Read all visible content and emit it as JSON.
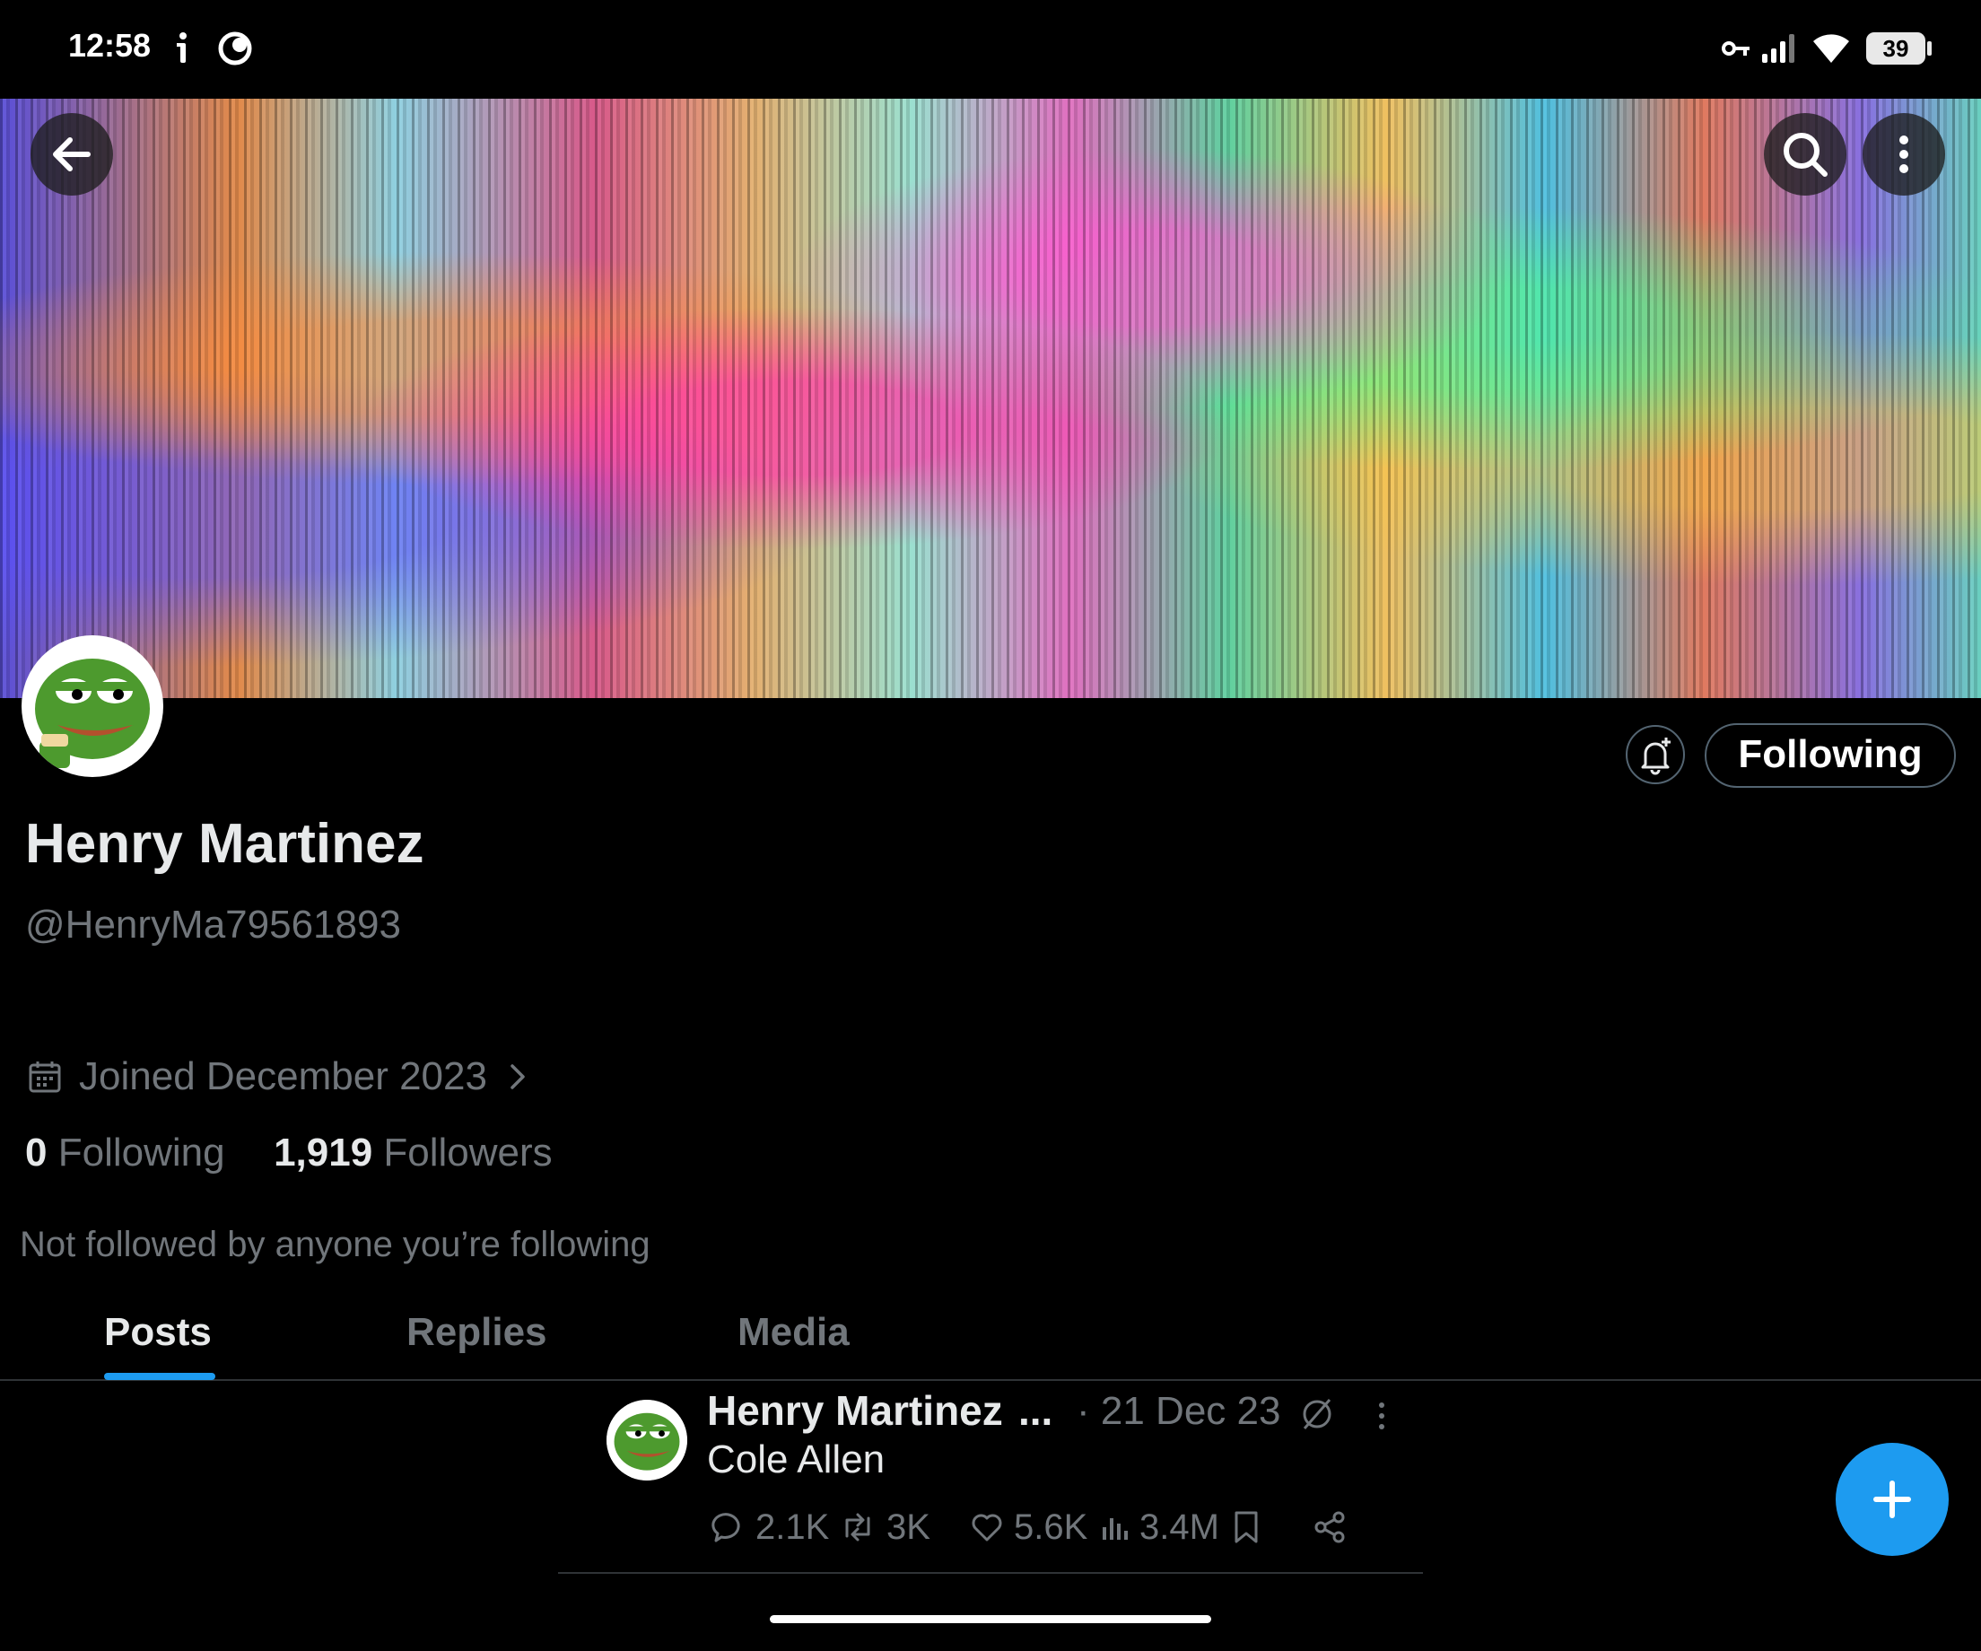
{
  "status_bar": {
    "time": "12:58",
    "battery": "39",
    "icons": [
      "notification-dot-icon",
      "moon-icon",
      "vpn-key-icon",
      "signal-icon",
      "wifi-icon",
      "battery-icon"
    ]
  },
  "header": {
    "icons": [
      "back-arrow-icon",
      "search-icon",
      "more-vertical-icon"
    ]
  },
  "profile": {
    "display_name": "Henry Martinez",
    "handle": "@HenryMa79561893",
    "joined": "Joined December 2023",
    "following_count": "0",
    "following_label": "Following",
    "followers_count": "1,919",
    "followers_label": "Followers",
    "not_followed": "Not followed by anyone you’re following",
    "follow_button": "Following"
  },
  "tabs": [
    {
      "label": "Posts",
      "active": true
    },
    {
      "label": "Replies",
      "active": false
    },
    {
      "label": "Media",
      "active": false
    }
  ],
  "post": {
    "author": "Henry Martinez",
    "ellipsis": "...",
    "date": "· 21 Dec 23",
    "text": "Cole Allen",
    "replies": "2.1K",
    "reposts": "3K",
    "likes": "5.6K",
    "views": "3.4M"
  },
  "colors": {
    "accent": "#1d9bf0",
    "text_primary": "#e7e9ea",
    "text_secondary": "#71767b",
    "background": "#000000",
    "border": "#2f3336"
  }
}
